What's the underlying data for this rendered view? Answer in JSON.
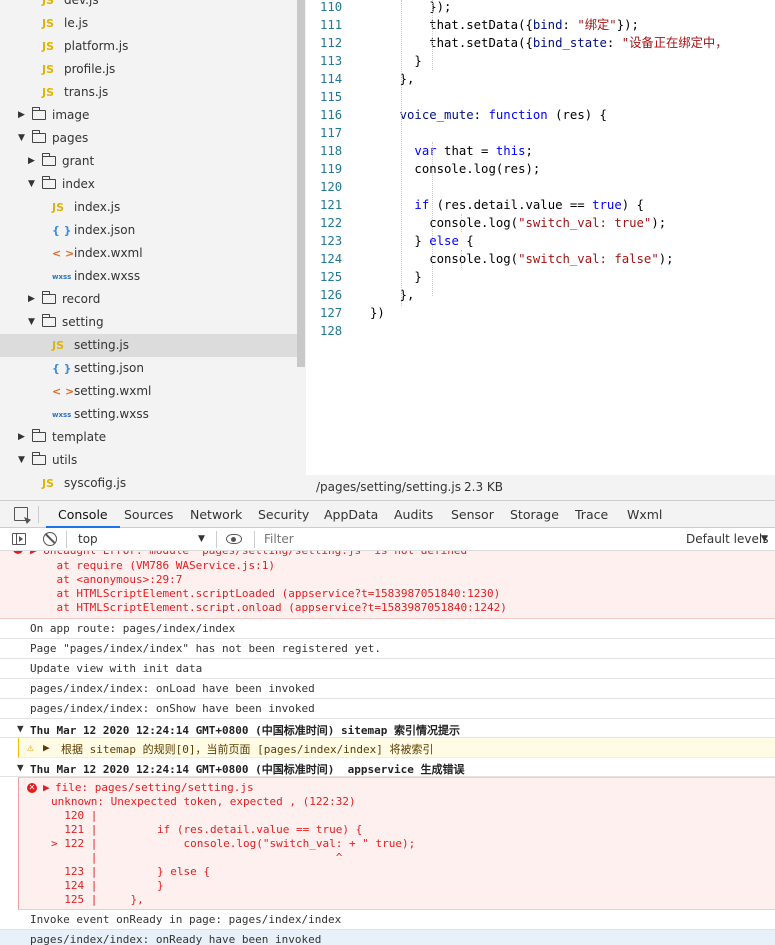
{
  "tree": {
    "items": [
      {
        "label": "dev.js",
        "kind": "js"
      },
      {
        "label": "le.js",
        "kind": "js"
      },
      {
        "label": "platform.js",
        "kind": "js"
      },
      {
        "label": "profile.js",
        "kind": "js"
      },
      {
        "label": "trans.js",
        "kind": "js"
      },
      {
        "label": "image",
        "kind": "folder"
      },
      {
        "label": "pages",
        "kind": "folder"
      },
      {
        "label": "grant",
        "kind": "folder"
      },
      {
        "label": "index",
        "kind": "folder"
      },
      {
        "label": "index.js",
        "kind": "js"
      },
      {
        "label": "index.json",
        "kind": "json"
      },
      {
        "label": "index.wxml",
        "kind": "wxml"
      },
      {
        "label": "index.wxss",
        "kind": "wxss"
      },
      {
        "label": "record",
        "kind": "folder"
      },
      {
        "label": "setting",
        "kind": "folder"
      },
      {
        "label": "setting.js",
        "kind": "js"
      },
      {
        "label": "setting.json",
        "kind": "json"
      },
      {
        "label": "setting.wxml",
        "kind": "wxml"
      },
      {
        "label": "setting.wxss",
        "kind": "wxss"
      },
      {
        "label": "template",
        "kind": "folder"
      },
      {
        "label": "utils",
        "kind": "folder"
      },
      {
        "label": "syscofig.js",
        "kind": "js"
      }
    ],
    "icons": {
      "js": "JS",
      "json": "{ }",
      "wxml": "< >",
      "wxss": "wxss"
    }
  },
  "editor": {
    "lines": [
      {
        "n": "110",
        "code": "        });"
      },
      {
        "n": "111",
        "code": "        that.setData({bind: \"绑定\"});"
      },
      {
        "n": "112",
        "code": "        that.setData({bind_state: \"设备正在绑定中，"
      },
      {
        "n": "113",
        "code": "      }"
      },
      {
        "n": "114",
        "code": "    },"
      },
      {
        "n": "115",
        "code": ""
      },
      {
        "n": "116",
        "code": "    voice_mute: function (res) {"
      },
      {
        "n": "117",
        "code": ""
      },
      {
        "n": "118",
        "code": "      var that = this;"
      },
      {
        "n": "119",
        "code": "      console.log(res);"
      },
      {
        "n": "120",
        "code": ""
      },
      {
        "n": "121",
        "code": "      if (res.detail.value == true) {"
      },
      {
        "n": "122",
        "code": "        console.log(\"switch_val: true\");"
      },
      {
        "n": "123",
        "code": "      } else {"
      },
      {
        "n": "124",
        "code": "        console.log(\"switch_val: false\");"
      },
      {
        "n": "125",
        "code": "      }"
      },
      {
        "n": "126",
        "code": "    },"
      },
      {
        "n": "127",
        "code": "})"
      },
      {
        "n": "128",
        "code": ""
      }
    ],
    "status_path": "/pages/setting/setting.js",
    "status_size": "2.3 KB"
  },
  "devtools": {
    "tabs": [
      "Console",
      "Sources",
      "Network",
      "Security",
      "AppData",
      "Audits",
      "Sensor",
      "Storage",
      "Trace",
      "Wxml"
    ],
    "active_tab": "Console",
    "context": "top",
    "filter_placeholder": "Filter",
    "levels": "Default levels"
  },
  "console": {
    "error1": [
      "Uncaught Error: module \"pages/setting/setting.js\" is not defined",
      "    at require (VM786 WAService.js:1)",
      "    at <anonymous>:29:7",
      "    at HTMLScriptElement.scriptLoaded (appservice?t=1583987051840:1230)",
      "    at HTMLScriptElement.script.onload (appservice?t=1583987051840:1242)"
    ],
    "logs": [
      "On app route: pages/index/index",
      "Page \"pages/index/index\" has not been registered yet.",
      "Update view with init data",
      "pages/index/index: onLoad have been invoked",
      "pages/index/index: onShow have been invoked"
    ],
    "group1": "Thu Mar 12 2020 12:24:14 GMT+0800 (中国标准时间) sitemap 索引情况提示",
    "warn1": "根据 sitemap 的规则[0]，当前页面 [pages/index/index] 将被索引",
    "group2": "Thu Mar 12 2020 12:24:14 GMT+0800 (中国标准时间)  appservice 生成错误",
    "error2": [
      "file: pages/setting/setting.js",
      "unknown: Unexpected token, expected , (122:32)",
      "  120 |",
      "  121 |         if (res.detail.value == true) {",
      "> 122 |             console.log(\"switch_val: + \" true);",
      "      |                                    ^",
      "  123 |         } else {",
      "  124 |         }",
      "  125 |     },"
    ],
    "logs2": [
      "Invoke event onReady in page: pages/index/index",
      "pages/index/index: onReady have been invoked"
    ]
  }
}
